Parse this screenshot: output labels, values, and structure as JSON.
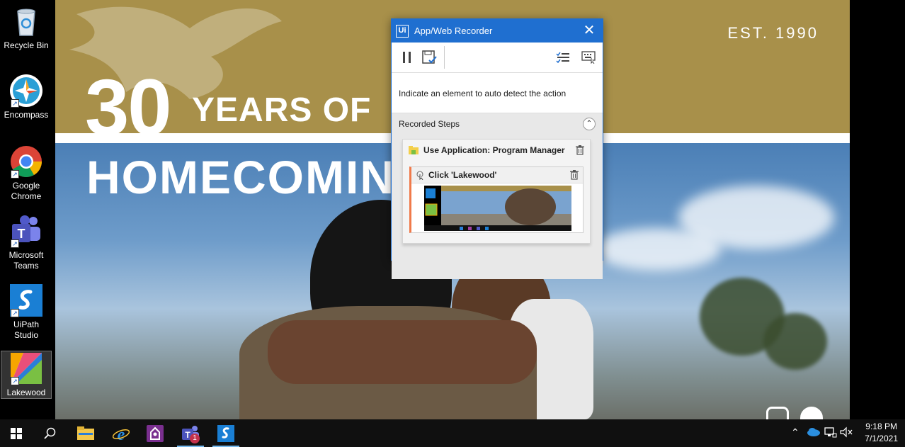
{
  "desktop": {
    "icons": [
      {
        "label": "Recycle Bin",
        "icon": "recycle-bin-icon"
      },
      {
        "label": "Encompass",
        "icon": "encompass-icon"
      },
      {
        "label": "Google Chrome",
        "icon": "chrome-icon"
      },
      {
        "label": "Microsoft Teams",
        "icon": "teams-icon"
      },
      {
        "label": "UiPath Studio",
        "icon": "uipath-studio-icon"
      },
      {
        "label": "Lakewood",
        "icon": "lakewood-icon",
        "selected": true
      }
    ]
  },
  "wallpaper": {
    "est": "EST. 1990",
    "big_number": "30",
    "headline_1": "YEARS OF",
    "headline_2": "HOMECOMIN",
    "colors": {
      "gold": "#a8904a",
      "sky": "#6e9cca"
    }
  },
  "recorder": {
    "logo": "Ui",
    "title": "App/Web Recorder",
    "close_label": "✕",
    "hint": "Indicate an element to auto detect the action",
    "steps_header": "Recorded Steps",
    "steps": [
      {
        "label": "Use Application: Program Manager",
        "children": [
          {
            "label": "Click 'Lakewood'"
          }
        ]
      }
    ],
    "toolbar": [
      "pause-icon",
      "save-icon",
      "checklist-icon",
      "keyboard-mouse-icon"
    ],
    "accent": "#1f6fd0",
    "step_accent": "#f07a4a"
  },
  "taskbar": {
    "apps": [
      "file-explorer-icon",
      "internet-explorer-icon",
      "lakewood-app-icon",
      "teams-icon",
      "uipath-icon"
    ],
    "teams_badge": "1",
    "time": "9:18 PM",
    "date": "7/1/2021"
  }
}
